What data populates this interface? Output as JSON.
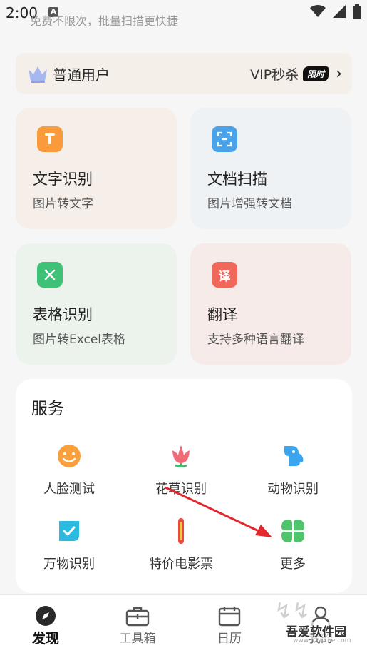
{
  "status_bar": {
    "time": "2:00",
    "notification_glyph": "A"
  },
  "subtitle": "免费不限次，批量扫描更快捷",
  "vip_bar": {
    "user_type": "普通用户",
    "vip_text": "VIP秒杀",
    "badge": "限时"
  },
  "cards": [
    {
      "title": "文字识别",
      "desc": "图片转文字",
      "icon": "text-recognition-icon",
      "icon_char": "T",
      "color": "#f99a3d"
    },
    {
      "title": "文档扫描",
      "desc": "图片增强转文档",
      "icon": "document-scan-icon",
      "color": "#4aa3ea"
    },
    {
      "title": "表格识别",
      "desc": "图片转Excel表格",
      "icon": "table-recognition-icon",
      "color": "#3fc177"
    },
    {
      "title": "翻译",
      "desc": "支持多种语言翻译",
      "icon": "translate-icon",
      "icon_char": "译",
      "color": "#f0685a"
    }
  ],
  "services": {
    "title": "服务",
    "items": [
      {
        "label": "人脸测试",
        "icon": "face-test-icon"
      },
      {
        "label": "花草识别",
        "icon": "flower-recognition-icon"
      },
      {
        "label": "动物识别",
        "icon": "animal-recognition-icon"
      },
      {
        "label": "万物识别",
        "icon": "object-recognition-icon"
      },
      {
        "label": "特价电影票",
        "icon": "movie-ticket-icon"
      },
      {
        "label": "更多",
        "icon": "more-icon"
      }
    ]
  },
  "tabs": [
    {
      "label": "发现",
      "icon": "discover-icon",
      "active": true
    },
    {
      "label": "工具箱",
      "icon": "toolbox-icon",
      "active": false
    },
    {
      "label": "日历",
      "icon": "calendar-icon",
      "active": false
    },
    {
      "label": "我的",
      "icon": "profile-icon",
      "active": false
    }
  ],
  "watermark": {
    "name": "吾爱软件园",
    "url": "www.52zixue.com"
  },
  "colors": {
    "accent_orange": "#f99a3d",
    "accent_blue": "#4aa3ea",
    "accent_green": "#3fc177",
    "accent_red": "#f0685a",
    "annotation_arrow": "#e0282e"
  }
}
